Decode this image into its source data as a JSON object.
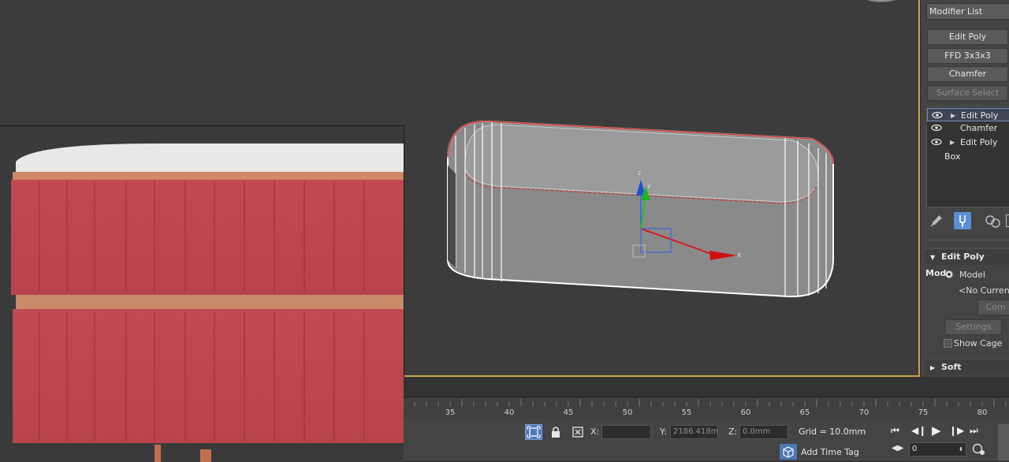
{
  "command_panel": {
    "modifier_list": "Modifier List",
    "buttons": [
      {
        "label": "Edit Poly",
        "enabled": true
      },
      {
        "label": "FFD 3x3x3",
        "enabled": true
      },
      {
        "label": "Chamfer",
        "enabled": true
      },
      {
        "label": "Surface Select",
        "enabled": false
      }
    ],
    "stack": [
      {
        "label": "Edit Poly",
        "eye": true,
        "expand": true,
        "selected": true
      },
      {
        "label": "Chamfer",
        "eye": true,
        "expand": false,
        "selected": false
      },
      {
        "label": "Edit Poly",
        "eye": true,
        "expand": true,
        "selected": false
      },
      {
        "label": "Box",
        "eye": false,
        "expand": false,
        "selected": false
      }
    ],
    "edit_poly_mode": {
      "title": "Edit Poly Mode",
      "radio_label": "Model",
      "no_current": "<No Current",
      "commit": "Com",
      "settings": "Settings",
      "show_cage": "Show Cage"
    },
    "soft_selection": "Soft Selection"
  },
  "viewport": {
    "gizmo": {
      "x_label": "x",
      "y_label": "y",
      "z_label": "z"
    }
  },
  "timeline": {
    "ticks": [
      "35",
      "40",
      "45",
      "50",
      "55",
      "60",
      "65",
      "70",
      "75",
      "80"
    ]
  },
  "status_bar": {
    "x_label": "X:",
    "x_value": "",
    "y_label": "Y:",
    "y_value": "2186.418m",
    "z_label": "Z:",
    "z_value": "0.0mm",
    "grid": "Grid = 10.0mm",
    "add_time_tag": "Add Time Tag",
    "frame_value": "0"
  },
  "colors": {
    "viewport_border": "#c8a44a",
    "accent_blue": "#5a8fd6"
  }
}
